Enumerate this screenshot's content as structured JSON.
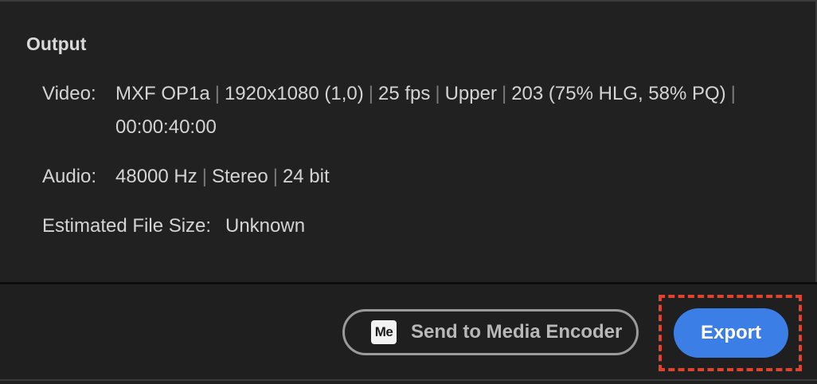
{
  "output": {
    "heading": "Output",
    "video": {
      "label": "Video:",
      "format": "MXF OP1a",
      "resolution": "1920x1080 (1,0)",
      "frame_rate": "25 fps",
      "field_order": "Upper",
      "codec_info": "203 (75% HLG, 58% PQ)",
      "duration": "00:00:40:00",
      "separator": "|"
    },
    "audio": {
      "label": "Audio:",
      "sample_rate": "48000 Hz",
      "channels": "Stereo",
      "bit_depth": "24 bit"
    },
    "file_size": {
      "label": "Estimated File Size:",
      "value": "Unknown"
    }
  },
  "footer": {
    "send_to_encoder": {
      "icon_text": "Me",
      "icon": "media-encoder-icon",
      "label": "Send to Media Encoder"
    },
    "export": {
      "label": "Export",
      "color": "#3b7ee6"
    },
    "highlight_color": "#e0432c"
  }
}
